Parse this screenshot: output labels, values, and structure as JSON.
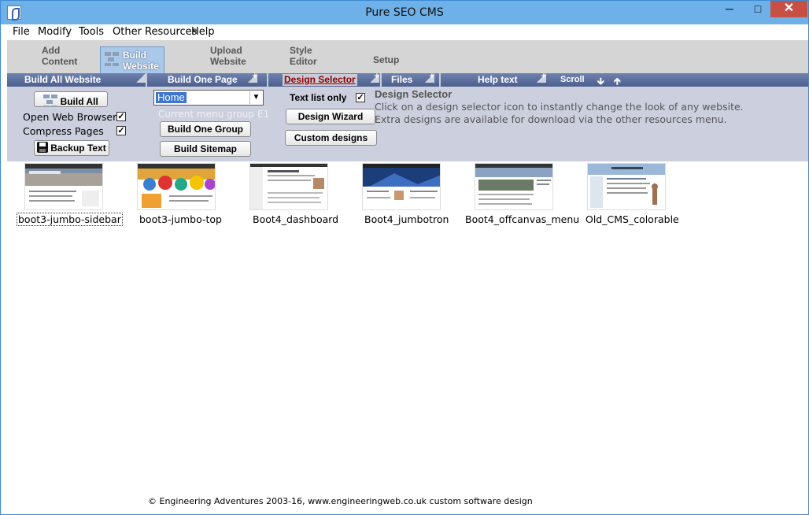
{
  "window": {
    "title": "Pure SEO CMS",
    "minimize": "─",
    "maximize": "□",
    "close": "✕"
  },
  "menu": [
    "File",
    "Modify",
    "Tools",
    "Other Resources",
    "Help"
  ],
  "main_tabs": [
    {
      "line1": "Add",
      "line2": "Content"
    },
    {
      "line1": "Build",
      "line2": "Website",
      "icon": "bricks-icon"
    },
    {
      "line1": "Upload",
      "line2": "Website"
    },
    {
      "line1": "Style",
      "line2": "Editor"
    },
    {
      "line1": "Setup",
      "line2": ""
    }
  ],
  "subnav": {
    "items": [
      "Build All Website",
      "Build One Page",
      "Design Selector",
      "Files",
      "Help text"
    ],
    "scroll": "Scroll",
    "scroll_down_icon": "arrow-down-icon",
    "scroll_up_icon": "arrow-up-icon",
    "plus": "+"
  },
  "panel": {
    "build_all": "Build All",
    "open_browser": "Open Web Browser",
    "compress_pages": "Compress Pages",
    "backup_text": "Backup Text",
    "page_select": "Home",
    "current_menu_group": "Current menu group",
    "menu_group_code": "E1",
    "build_one_group": "Build One Group",
    "build_sitemap": "Build Sitemap",
    "text_list_only": "Text list only",
    "design_wizard": "Design Wizard",
    "custom_designs": "Custom designs",
    "info_title": "Design Selector",
    "info_line1": "Click on a design selector icon to instantly change the look of any website.",
    "info_line2": "Extra designs are available for download via the other resources menu.",
    "check_mark": "✓"
  },
  "designs": [
    {
      "label": "boot3-jumbo-sidebar",
      "selected": true
    },
    {
      "label": "boot3-jumbo-top"
    },
    {
      "label": "Boot4_dashboard"
    },
    {
      "label": "Boot4_jumbotron"
    },
    {
      "label": "Boot4_offcanvas_menu"
    },
    {
      "label": "Old_CMS_colorable"
    }
  ],
  "footer": "© Engineering Adventures 2003-16,  www.engineeringweb.co.uk custom software design",
  "colors": {
    "titlebar": "#6eb0e8",
    "subnav": "#5a6b98",
    "panel": "#ccd0de",
    "active_link": "#8b0000",
    "close": "#c74f44"
  }
}
